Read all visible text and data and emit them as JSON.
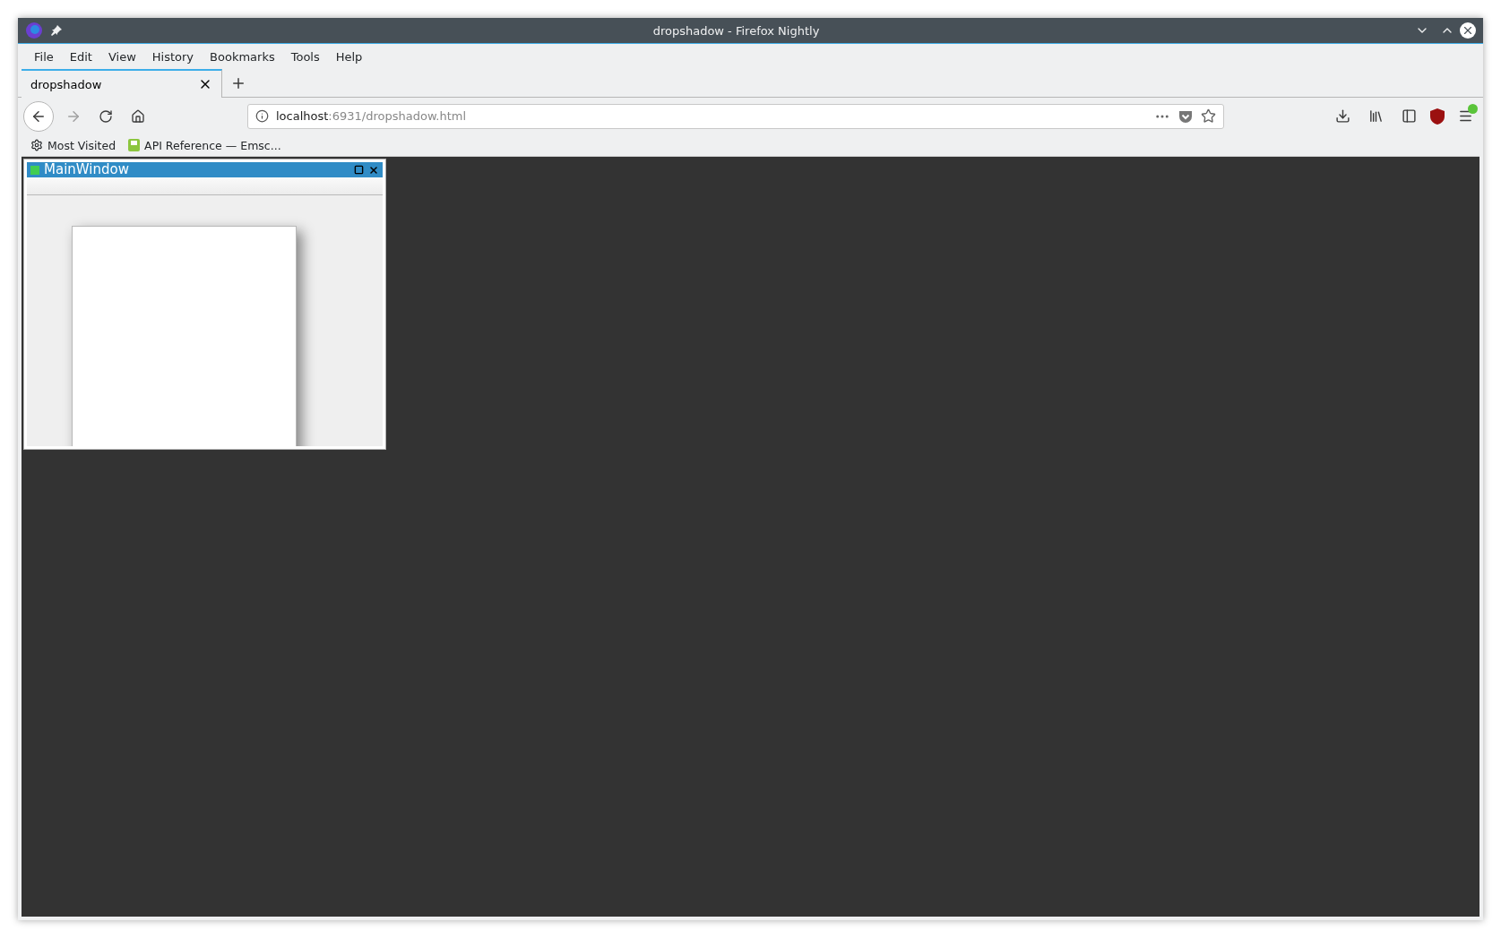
{
  "window": {
    "title": "dropshadow - Firefox Nightly"
  },
  "menu": [
    "File",
    "Edit",
    "View",
    "History",
    "Bookmarks",
    "Tools",
    "Help"
  ],
  "tabs": [
    {
      "label": "dropshadow",
      "selected": true
    }
  ],
  "url": {
    "host": "localhost",
    "path": ":6931/dropshadow.html"
  },
  "bookmarks": [
    {
      "kind": "gear",
      "label": "Most Visited"
    },
    {
      "kind": "page",
      "label": "API Reference — Emsc..."
    }
  ],
  "qt_window": {
    "title": "MainWindow"
  }
}
